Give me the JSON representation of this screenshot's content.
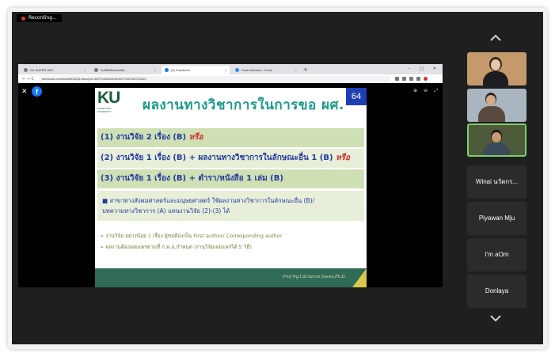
{
  "recording": {
    "label": "Recording..."
  },
  "browser": {
    "tabs": [
      {
        "label": "KU SUPER WiFi",
        "active": false
      },
      {
        "label": "SuitReflectiveNik...",
        "active": false
      },
      {
        "label": "(9) Facebook",
        "active": true
      },
      {
        "label": "Post-Interview - Zoom",
        "active": false
      }
    ],
    "new_tab": "+",
    "window_controls": {
      "minimize": "–",
      "maximize": "□",
      "close": "✕"
    },
    "nav": "← → C",
    "url": "facebook.com/suwit6062/photos/pcb.4697246840306/4697246906726420"
  },
  "viewer": {
    "close": "✕",
    "logo": "f",
    "tools": {
      "zoom_in": "⊕",
      "zoom_out": "⊖",
      "fullscreen": "⤢"
    }
  },
  "slide": {
    "logo_letters": "KU",
    "logo_text": "KASETSART UNIVERSITY",
    "title": "ผลงานทางวิชาการในการขอ ผศ.",
    "page_number": "64",
    "rows": [
      {
        "text": "(1) งานวิจัย 2 เรื่อง (B) ",
        "emph": "หรือ"
      },
      {
        "text": "(2) งานวิจัย 1 เรื่อง (B) + ผลงานทางวิชาการในลักษณะอื่น 1 (B) ",
        "emph": "หรือ"
      },
      {
        "text": "(3) งานวิจัย 1 เรื่อง (B) + ตำรา/หนังสือ 1 เล่ม (B)",
        "emph": ""
      }
    ],
    "note_line1": "สาขาทางสังคมศาสตร์และมนุษยศาสตร์ ใช้ผลงานทางวิชาการในลักษณะอื่น (B)/",
    "note_line2": "บทความทางวิชาการ (A) แทนงานวิจัย (2)-(3) ได้",
    "bullet1": "งานวิจัย อย่างน้อย 1 เรื่อง ผู้ขอต้องเป็น First author/ Corresponding author",
    "bullet2": "ผลงานต้องเผยแพร่ตามที่ ก.พ.อ.กำหนด (งานวิจัยเผยแพร่ได้ 5 วิธี)",
    "credit": "Prof.Wg.Cdr.Surrat Suwan,Ph.D."
  },
  "participants": {
    "named": [
      {
        "name": "Winai นวัตกร..."
      },
      {
        "name": "Piyawan Mju"
      },
      {
        "name": "I'm aOm"
      },
      {
        "name": "Donlaya"
      }
    ]
  },
  "colors": {
    "slide_title": "#1a9a8a",
    "row_text": "#233aa0",
    "emph": "#d32f2f",
    "active_speaker": "#7cd06b"
  }
}
